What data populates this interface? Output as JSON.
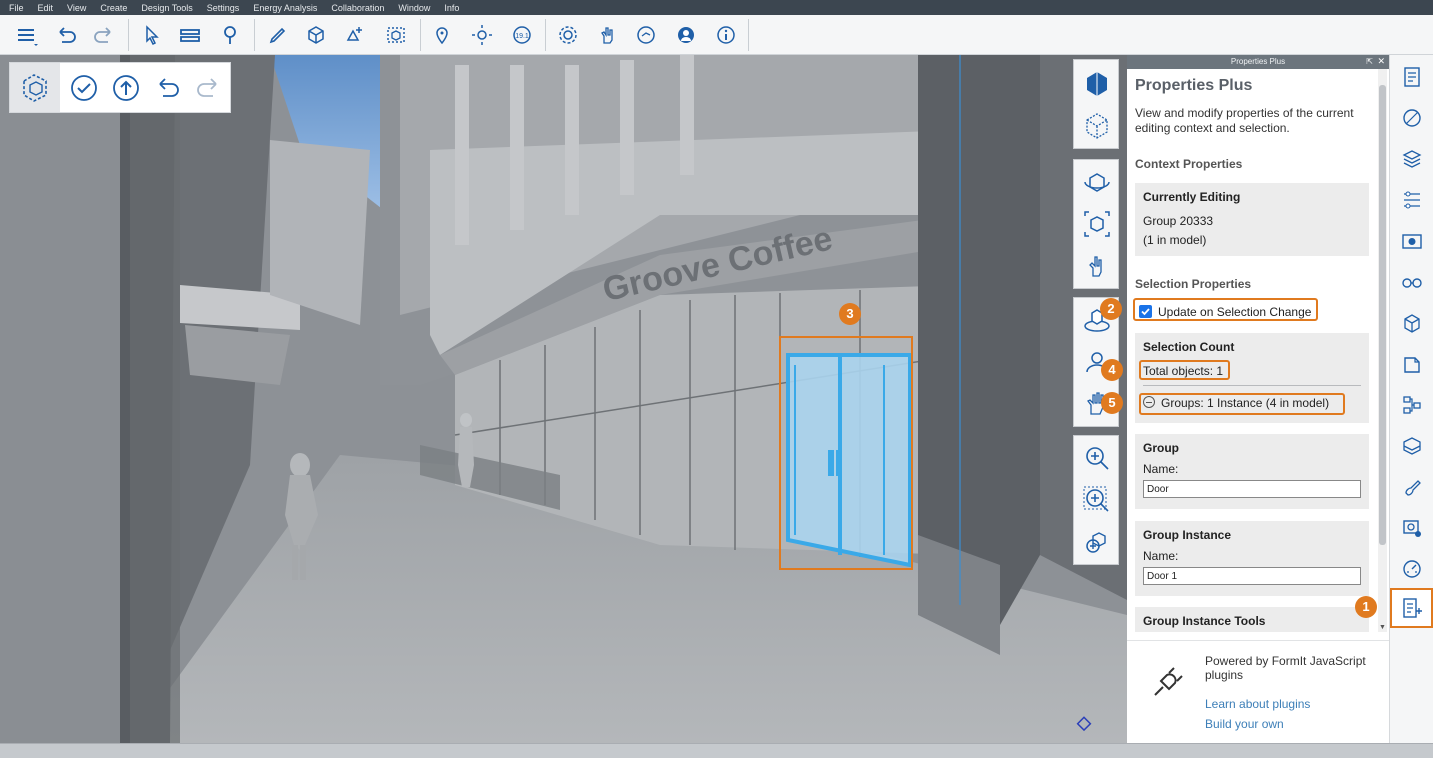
{
  "menu": [
    "File",
    "Edit",
    "View",
    "Create",
    "Design Tools",
    "Settings",
    "Energy Analysis",
    "Collaboration",
    "Window",
    "Info"
  ],
  "toolbar_icons": [
    "layers-icon",
    "undo-icon",
    "redo-icon",
    "select-icon",
    "level-icon",
    "light-bulb-icon",
    "pencil-icon",
    "cube-icon",
    "add-object-icon",
    "group-icon",
    "location-pin-icon",
    "sun-icon",
    "scale-icon",
    "gear-icon",
    "hand-icon",
    "share-icon",
    "user-icon",
    "info-icon"
  ],
  "edit_toolbar_icons": [
    "edit-context-icon",
    "check-icon",
    "up-arrow-icon",
    "undo-context-icon",
    "redo-context-icon"
  ],
  "view_tools_icons": [
    "view-cube-icon",
    "view-perspective-icon",
    "orbit-icon",
    "zoom-extents-icon",
    "look-around-icon",
    "walk-icon",
    "fly-icon",
    "pan-icon",
    "zoom-in-icon",
    "zoom-window-icon",
    "zoom-selection-icon"
  ],
  "scene": {
    "sign_text": "Groove Coffee"
  },
  "panel": {
    "window_title": "Properties Plus",
    "heading": "Properties Plus",
    "description": "View and modify properties of the current editing context and selection.",
    "context_section": "Context Properties",
    "currently_editing": {
      "title": "Currently Editing",
      "group": "Group 20333",
      "count": "(1 in model)"
    },
    "selection_section": "Selection Properties",
    "update_checkbox": {
      "label": "Update on Selection Change",
      "checked": true
    },
    "selection_count": {
      "title": "Selection Count",
      "total": "Total objects: 1",
      "groups": "Groups: 1 Instance (4 in model)"
    },
    "group": {
      "title": "Group",
      "name_label": "Name:",
      "name_value": "Door"
    },
    "group_instance": {
      "title": "Group Instance",
      "name_label": "Name:",
      "name_value": "Door 1"
    },
    "group_instance_tools": "Group Instance Tools",
    "footer": {
      "powered_by": "Powered by FormIt JavaScript plugins",
      "learn_link": "Learn about plugins",
      "build_link": "Build your own"
    }
  },
  "callouts": [
    "1",
    "2",
    "3",
    "4",
    "5"
  ],
  "strip_icons": [
    "properties-icon",
    "materials-icon",
    "layers-panel-icon",
    "levels-icon",
    "scenes-icon",
    "visual-styles-icon",
    "groups-icon",
    "content-library-icon",
    "group-tree-icon",
    "library-icon",
    "paint-icon",
    "scene-camera-icon",
    "dashboard-icon",
    "properties-plus-icon"
  ],
  "colors": {
    "accent_orange": "#e07a1f",
    "selection_blue": "#3aa9e8",
    "link_blue": "#3d7fb8"
  }
}
